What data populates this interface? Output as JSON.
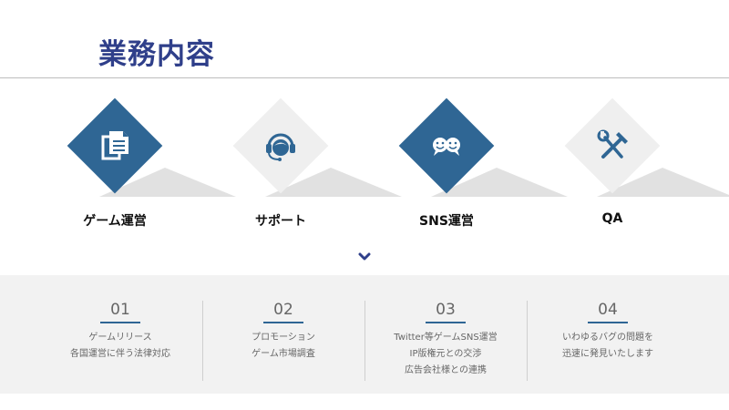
{
  "page": {
    "title": "業務内容"
  },
  "colors": {
    "accent_blue": "#2f6694",
    "title_blue": "#2f3f8a",
    "panel_bg": "#f2f2f2"
  },
  "services": [
    {
      "label": "ゲーム運営",
      "icon": "documents-icon"
    },
    {
      "label": "サポート",
      "icon": "headset-icon"
    },
    {
      "label": "SNS運営",
      "icon": "chat-faces-icon"
    },
    {
      "label": "QA",
      "icon": "tools-icon"
    }
  ],
  "details": [
    {
      "number": "01",
      "lines": [
        "ゲームリリース",
        "各国運営に伴う法律対応"
      ]
    },
    {
      "number": "02",
      "lines": [
        "プロモーション",
        "ゲーム市場調査"
      ]
    },
    {
      "number": "03",
      "lines": [
        "Twitter等ゲームSNS運営",
        "IP版権元との交渉",
        "広告会社様との連携"
      ]
    },
    {
      "number": "04",
      "lines": [
        "いわゆるバグの問題を",
        "迅速に発見いたします"
      ]
    }
  ]
}
